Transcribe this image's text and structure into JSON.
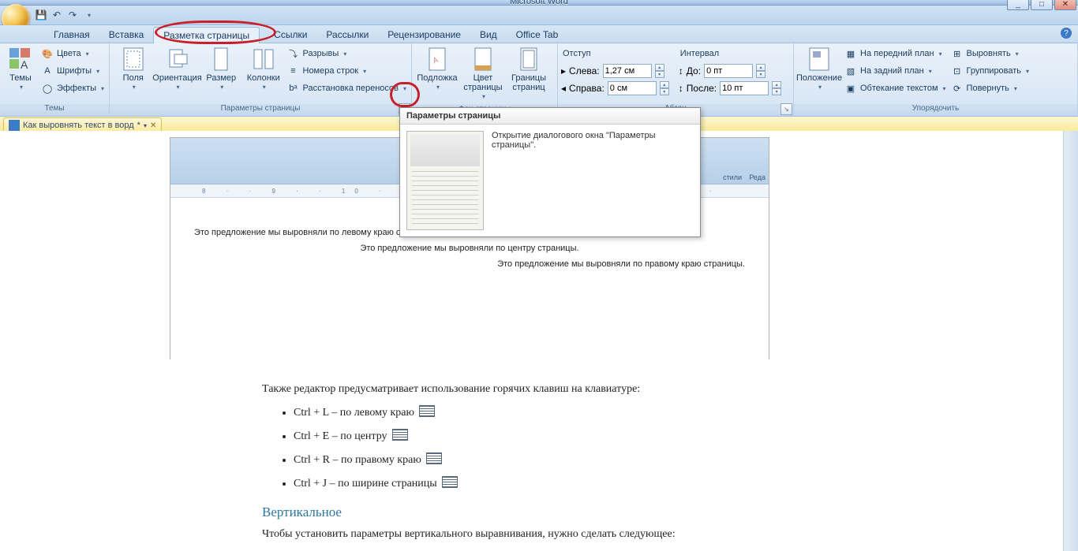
{
  "title_suffix": "Microsoft Word",
  "window": {
    "min": "_",
    "max": "□",
    "close": "✕"
  },
  "tabs": {
    "home": "Главная",
    "insert": "Вставка",
    "layout": "Разметка страницы",
    "refs": "Ссылки",
    "mail": "Рассылки",
    "review": "Рецензирование",
    "view": "Вид",
    "office": "Office Tab"
  },
  "groups": {
    "themes": "Темы",
    "page_setup": "Параметры страницы",
    "page_bg": "Фон страницы",
    "paragraph": "Абзац",
    "arrange": "Упорядочить"
  },
  "themes": {
    "themes": "Темы",
    "colors": "Цвета",
    "fonts": "Шрифты",
    "effects": "Эффекты"
  },
  "page_setup": {
    "margins": "Поля",
    "orientation": "Ориентация",
    "size": "Размер",
    "columns": "Колонки",
    "breaks": "Разрывы",
    "line_numbers": "Номера строк",
    "hyphenation": "Расстановка переносов"
  },
  "page_bg": {
    "watermark": "Подложка",
    "page_color": "Цвет страницы",
    "borders": "Границы страниц"
  },
  "paragraph": {
    "indent": "Отступ",
    "left": "Слева:",
    "right": "Справа:",
    "spacing": "Интервал",
    "before": "До:",
    "after": "После:",
    "left_val": "1,27 см",
    "right_val": "0 см",
    "before_val": "0 пт",
    "after_val": "10 пт"
  },
  "arrange": {
    "position": "Положение",
    "front": "На передний план",
    "back": "На задний план",
    "wrap": "Обтекание текстом",
    "align": "Выровнять",
    "group": "Группировать",
    "rotate": "Повернуть"
  },
  "doctab": {
    "name": "Как выровнять текст в ворд",
    "star": "*"
  },
  "tooltip": {
    "title": "Параметры страницы",
    "body": "Открытие диалогового окна \"Параметры страницы\"."
  },
  "inner": {
    "ruler": "8 · · 9 · · 10 · · 11 · · 12 · · 13 · · 14 ·",
    "styles": "стили",
    "p1": "Это предложение мы выровняли по левому краю страницы.",
    "p2": "Это предложение мы выровняли по центру страницы.",
    "p3": "Это предложение мы выровняли по правому краю страницы."
  },
  "article": {
    "lead": "Также редактор предусматривает использование горячих клавиш на клавиатуре:",
    "i1": "Ctrl + L – по левому краю",
    "i2": "Ctrl + E – по центру",
    "i3": "Ctrl + R – по правому краю",
    "i4": "Ctrl + J – по ширине страницы",
    "h": "Вертикальное",
    "p2": "Чтобы установить параметры вертикального выравнивания, нужно сделать следующее:"
  }
}
